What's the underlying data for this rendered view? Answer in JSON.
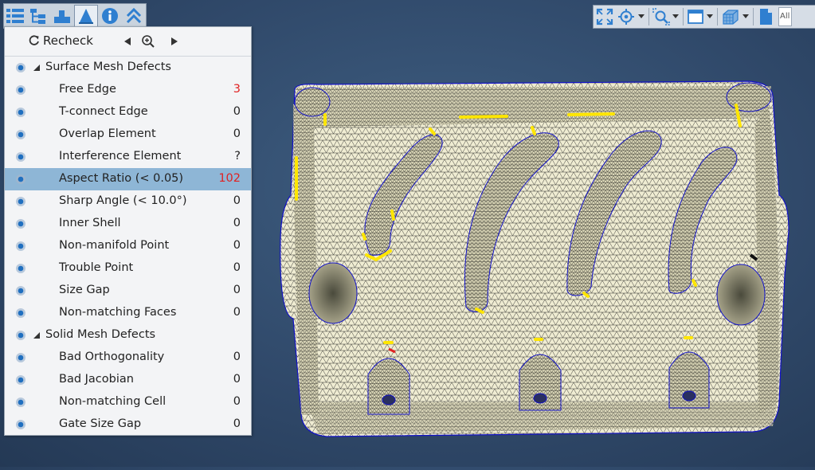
{
  "toolbar": {
    "recheck_label": "Recheck",
    "tab_icons": [
      "list-icon",
      "tree-icon",
      "mesh-icon",
      "defect-cone-icon",
      "info-icon",
      "collapse-up-icon"
    ]
  },
  "defects": {
    "groups": [
      {
        "label": "Surface Mesh Defects",
        "items": [
          {
            "label": "Free Edge",
            "count": "3"
          },
          {
            "label": "T-connect Edge",
            "count": "0"
          },
          {
            "label": "Overlap Element",
            "count": "0"
          },
          {
            "label": "Interference Element",
            "count": "?"
          },
          {
            "label": "Aspect Ratio (< 0.05)",
            "count": "102"
          },
          {
            "label": "Sharp Angle (< 10.0°)",
            "count": "0"
          },
          {
            "label": "Inner Shell",
            "count": "0"
          },
          {
            "label": "Non-manifold Point",
            "count": "0"
          },
          {
            "label": "Trouble Point",
            "count": "0"
          },
          {
            "label": "Size Gap",
            "count": "0"
          },
          {
            "label": "Non-matching Faces",
            "count": "0"
          }
        ]
      },
      {
        "label": "Solid Mesh Defects",
        "items": [
          {
            "label": "Bad Orthogonality",
            "count": "0"
          },
          {
            "label": "Bad Jacobian",
            "count": "0"
          },
          {
            "label": "Non-matching Cell",
            "count": "0"
          },
          {
            "label": "Gate Size Gap",
            "count": "0"
          }
        ]
      }
    ],
    "selected_item": "Aspect Ratio (< 0.05)"
  },
  "view_toolbar": {
    "filter_value": "All"
  },
  "colors": {
    "highlight_defect": "#ffe600",
    "mesh_fill": "#efecd2",
    "mesh_line": "#1e1e1e",
    "boundary": "#1212c8",
    "count_nonzero": "#e02222",
    "selection": "#8eb6d6",
    "background": "#30496a"
  }
}
